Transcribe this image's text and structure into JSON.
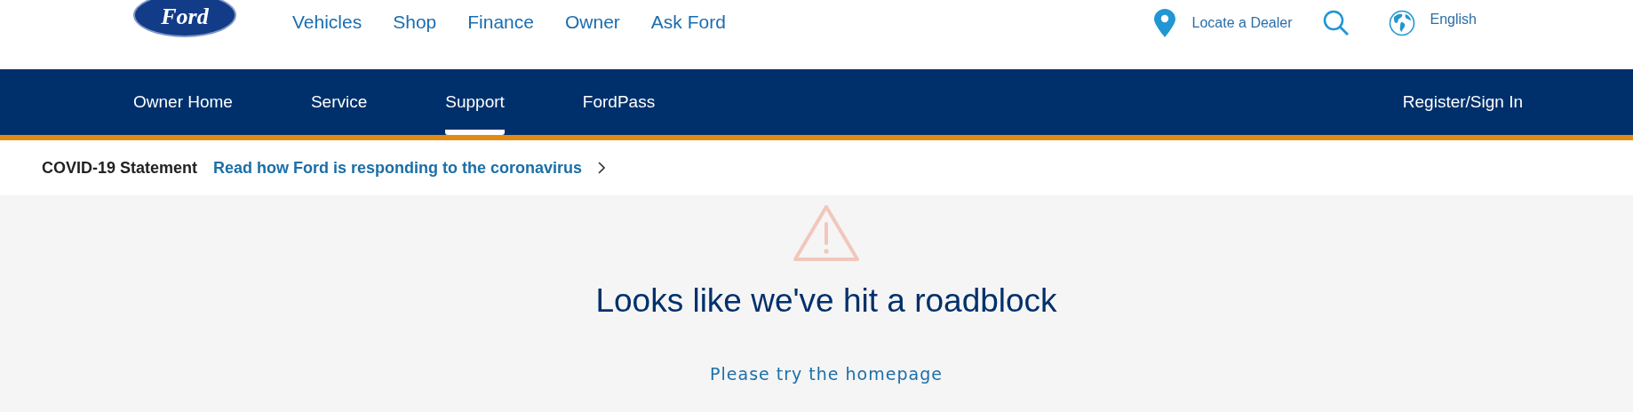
{
  "logo": {
    "text": "Ford"
  },
  "main_nav": [
    {
      "label": "Vehicles"
    },
    {
      "label": "Shop"
    },
    {
      "label": "Finance"
    },
    {
      "label": "Owner"
    },
    {
      "label": "Ask Ford"
    }
  ],
  "utility_nav": {
    "dealer": "Locate a Dealer",
    "language": "English"
  },
  "owner_nav": {
    "items": [
      {
        "label": "Owner Home",
        "selected": false
      },
      {
        "label": "Service",
        "selected": false
      },
      {
        "label": "Support",
        "selected": true
      },
      {
        "label": "FordPass",
        "selected": false
      }
    ],
    "account": "Register/Sign In"
  },
  "notice": {
    "title": "COVID-19 Statement",
    "link": "Read how Ford is responding to the coronavirus"
  },
  "error": {
    "heading": "Looks like we've hit a roadblock",
    "link": "Please try the homepage"
  }
}
